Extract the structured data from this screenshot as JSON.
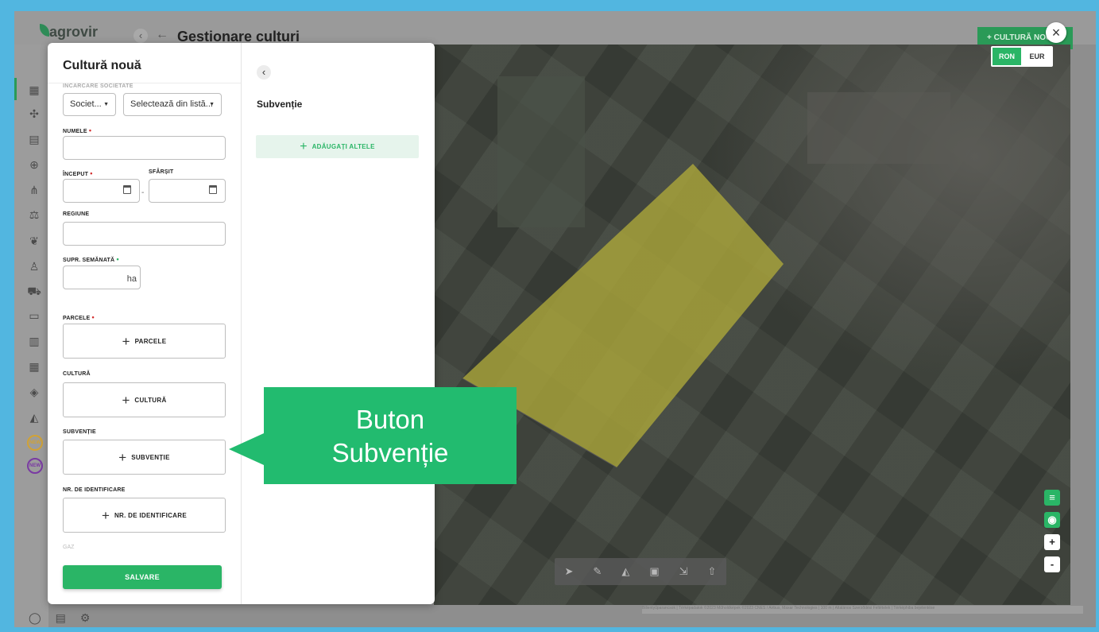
{
  "app": {
    "logo_text": "agrovir",
    "page_title": "Gestionare culturi",
    "new_crop_button": "+ CULTURĂ NOUĂ",
    "close_glyph": "×"
  },
  "currency": {
    "options": [
      "RON",
      "EUR"
    ],
    "selected": "RON"
  },
  "modal": {
    "title": "Cultură nouă",
    "faded_section_label": "ÎNCĂRCARE SOCIETATE",
    "company_select": "Societ...",
    "list_select": "Selectează din listă...",
    "name_label": "NUMELE",
    "start_label": "ÎNCEPUT",
    "end_label": "SFÂRȘIT",
    "region_label": "REGIUNE",
    "sown_area_label": "SUPR. SEMĂNATĂ",
    "area_unit": "ha",
    "parcels_label": "PARCELE",
    "parcels_button": "PARCELE",
    "crop_label": "CULTURĂ",
    "crop_button": "CULTURĂ",
    "subsidy_label": "SUBVENȚIE",
    "subsidy_button": "SUBVENȚIE",
    "id_label": "NR. DE IDENTIFICARE",
    "id_button": "NR. DE IDENTIFICARE",
    "gas_label": "GAZ",
    "save_button": "SALVARE",
    "required_mark": "•"
  },
  "subsidy_panel": {
    "title": "Subvenție",
    "add_other_button": "ADĂUGAȚI ALTELE"
  },
  "callout": {
    "text": "Buton\nSubvenție"
  },
  "map": {
    "attribution": "Billentyűparancsok | Térképadatok ©2023 Műholdképek ©2023 CNES / Airbus, Maxar Technologies | 100 m | Általános Szerződési Feltételek | Térképhiba bejelentése",
    "field_color": "#b7b33f"
  },
  "icons": {
    "sidebar": [
      "crop-icon",
      "puzzle-icon",
      "document-icon",
      "money-icon",
      "flow-icon",
      "scale-icon",
      "plant-icon",
      "workers-icon",
      "tractor-icon",
      "id-card-icon",
      "table-icon",
      "grid-icon",
      "map-icon",
      "field-icon",
      "new-badge-icon",
      "new-badge-icon"
    ]
  }
}
